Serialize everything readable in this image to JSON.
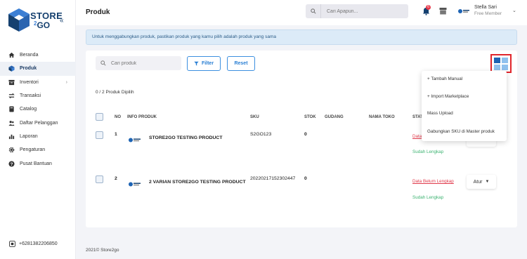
{
  "brand": {
    "top": "STORE",
    "two": "2",
    "bottom": "GO"
  },
  "sidebar": {
    "items": [
      {
        "label": "Beranda",
        "icon": "home-icon"
      },
      {
        "label": "Produk",
        "icon": "box-icon"
      },
      {
        "label": "Inventori",
        "icon": "inventory-icon"
      },
      {
        "label": "Transaksi",
        "icon": "transaction-icon"
      },
      {
        "label": "Catalog",
        "icon": "catalog-icon"
      },
      {
        "label": "Daftar Pelanggan",
        "icon": "customers-icon"
      },
      {
        "label": "Laporan",
        "icon": "report-icon"
      },
      {
        "label": "Pengaturan",
        "icon": "gear-icon"
      },
      {
        "label": "Pusat Bantuan",
        "icon": "help-icon"
      }
    ],
    "phone": "+6281382206850"
  },
  "header": {
    "title": "Produk",
    "search_placeholder": "Cari Apapun...",
    "notif_count": "6",
    "user_name": "Stella Sari",
    "user_role": "Free Member"
  },
  "alert": "Untuk menggabungkan produk, pastikan produk yang kamu pilih adalah produk yang sama",
  "toolbar": {
    "search_placeholder": "Cari produk",
    "filter_label": "Filter",
    "reset_label": "Reset"
  },
  "selected_count": "0 / 2 Produk Dipilih",
  "table": {
    "headers": {
      "no": "NO",
      "info": "INFO PRODUK",
      "sku": "SKU",
      "stok": "STOK",
      "gudang": "GUDANG",
      "toko": "NAMA TOKO",
      "status": "STAT"
    },
    "rows": [
      {
        "no": "1",
        "name": "STORE2GO TESTING PRODUCT",
        "sku": "S2GO123",
        "stok": "0",
        "status_red": "Data",
        "status_green": "Sudah Lengkap"
      },
      {
        "no": "2",
        "name": "2 VARIAN STORE2GO TESTING PRODUCT",
        "sku": "20220217152302447",
        "stok": "0",
        "status_red": "Data Belum Lengkap",
        "status_green": "Sudah Lengkap",
        "action": "Atur"
      }
    ]
  },
  "dropdown": [
    "+ Tambah Manual",
    "+ Import Marketplace",
    "Mass Upload",
    "Gabungkan SKU di Master produk"
  ],
  "footer": {
    "year": "2021©",
    "brand": "Store2go"
  },
  "colors": {
    "primary": "#2a7fd4",
    "navy": "#15406f",
    "danger": "#e0394a",
    "success": "#3cb371"
  }
}
